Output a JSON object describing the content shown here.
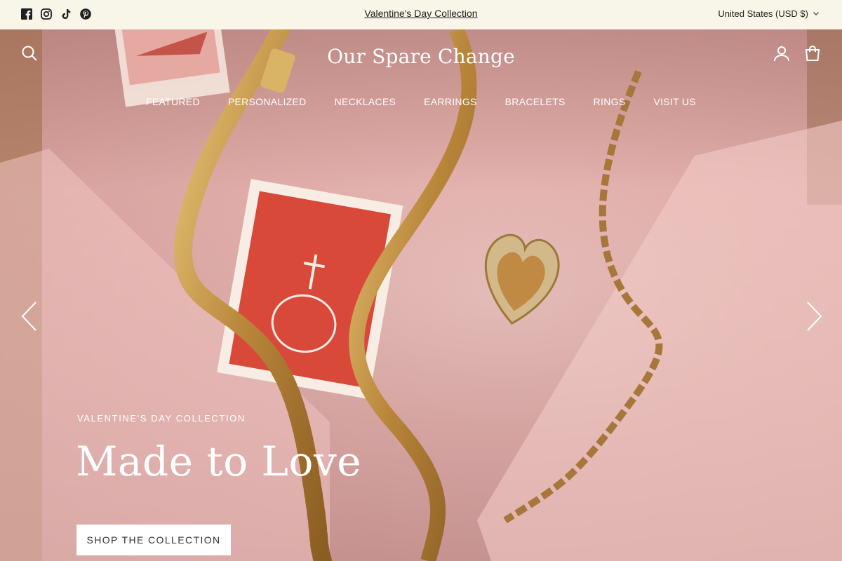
{
  "announcement": {
    "social_icons": [
      "facebook-icon",
      "instagram-icon",
      "tiktok-icon",
      "pinterest-icon"
    ],
    "link_text": "Valentine's Day Collection",
    "currency": "United States (USD $)"
  },
  "header": {
    "brand": "Our Spare Change",
    "nav": [
      "FEATURED",
      "PERSONALIZED",
      "NECKLACES",
      "EARRINGS",
      "BRACELETS",
      "RINGS",
      "VISIT US"
    ]
  },
  "hero": {
    "eyebrow": "VALENTINE'S DAY COLLECTION",
    "headline": "Made to Love",
    "cta_label": "SHOP THE COLLECTION"
  },
  "colors": {
    "announcement_bg": "#f8f5e9",
    "hero_bg": "#e6b3b0",
    "gold": "#c99a45",
    "stamp_red": "#d9493a"
  }
}
